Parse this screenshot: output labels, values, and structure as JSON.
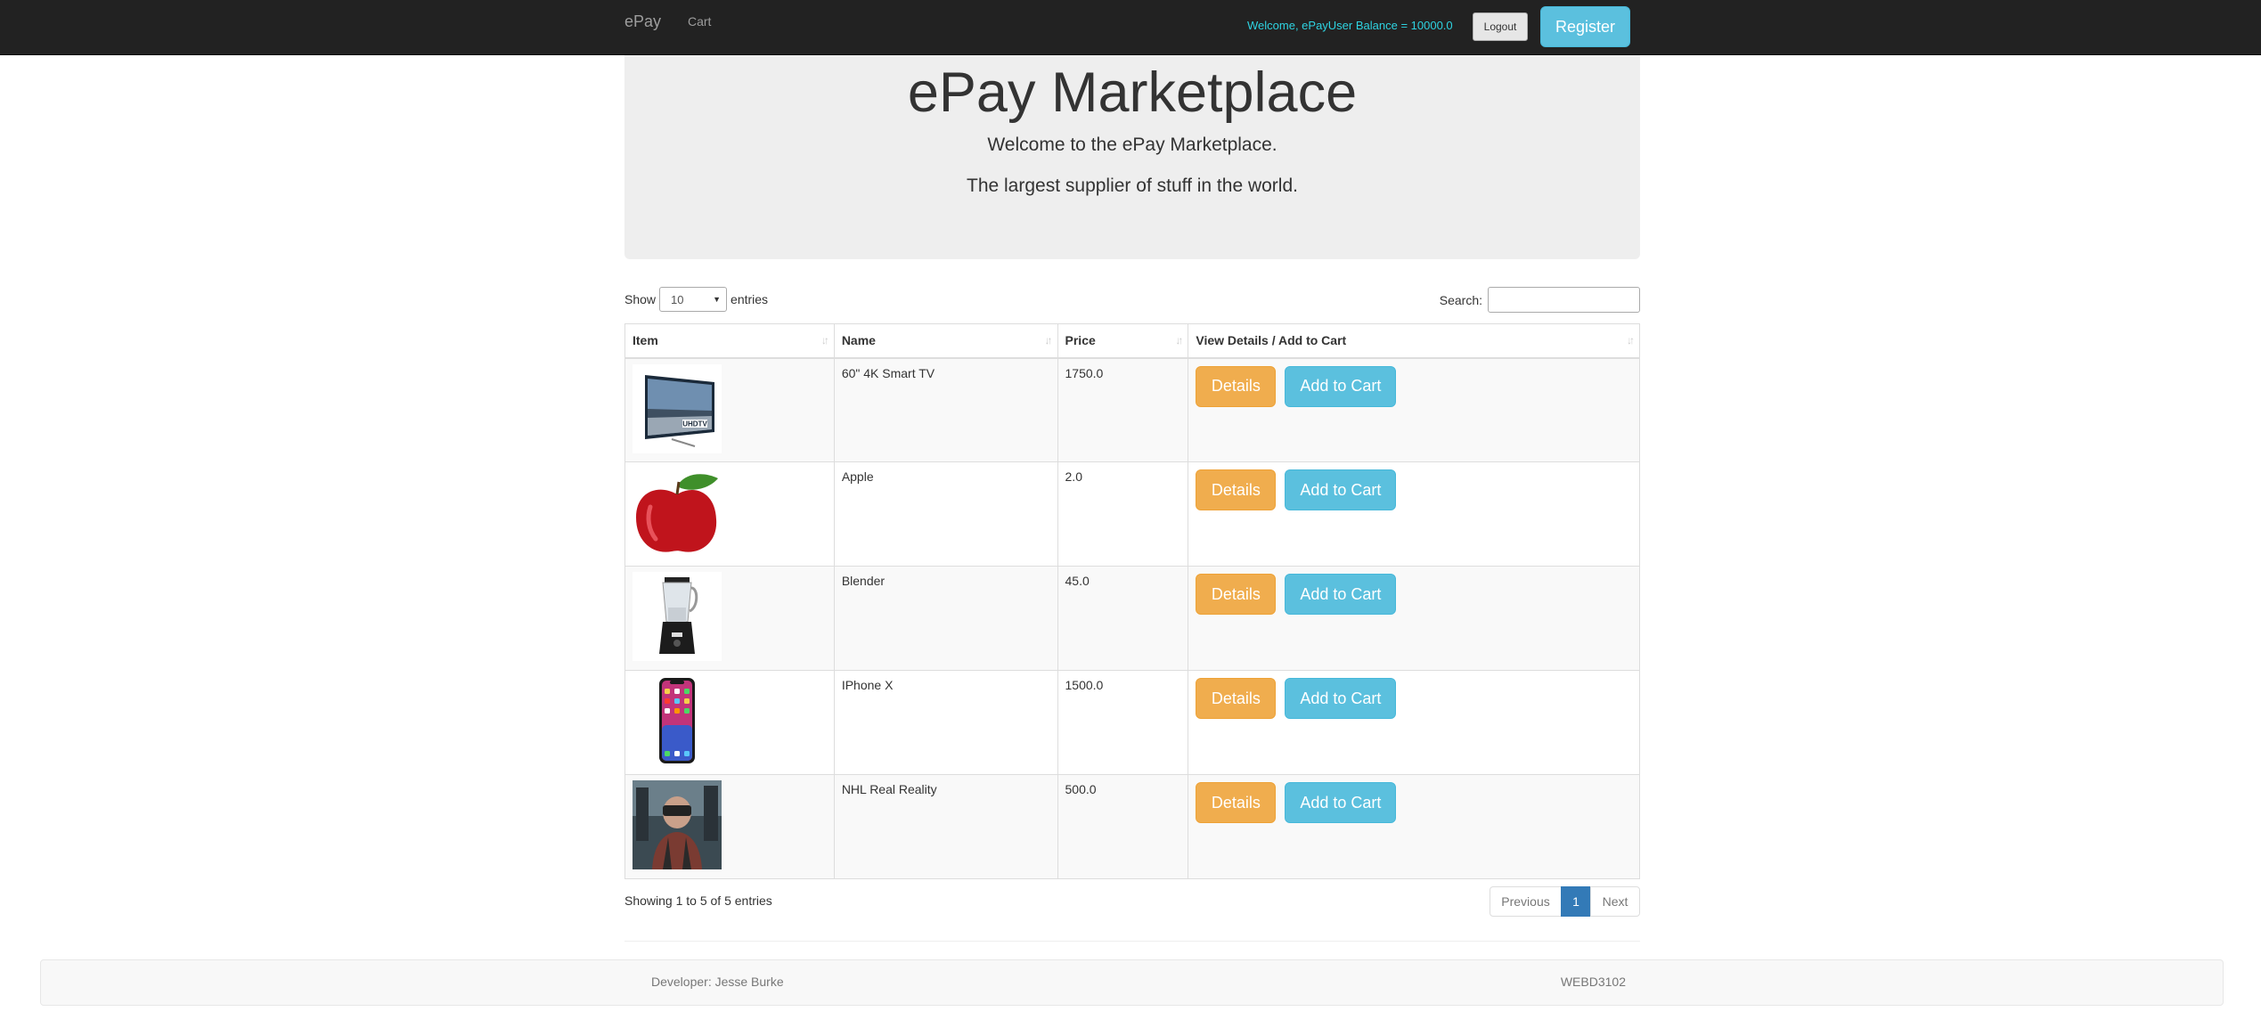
{
  "navbar": {
    "brand": "ePay",
    "cart_link": "Cart",
    "welcome_text": "Welcome, ePayUser Balance = 10000.0",
    "logout_label": "Logout",
    "register_label": "Register"
  },
  "jumbotron": {
    "title": "ePay Marketplace",
    "line1": "Welcome to the ePay Marketplace.",
    "line2": "The largest supplier of stuff in the world."
  },
  "table_controls": {
    "show_label": "Show",
    "entries_value": "10",
    "entries_label": "entries",
    "search_label": "Search:",
    "search_value": ""
  },
  "table": {
    "headers": [
      "Item",
      "Name",
      "Price",
      "View Details / Add to Cart"
    ],
    "rows": [
      {
        "image": "smart-tv",
        "name": "60\" 4K Smart TV",
        "price": "1750.0",
        "details_label": "Details",
        "cart_label": "Add to Cart"
      },
      {
        "image": "apple",
        "name": "Apple",
        "price": "2.0",
        "details_label": "Details",
        "cart_label": "Add to Cart"
      },
      {
        "image": "blender",
        "name": "Blender",
        "price": "45.0",
        "details_label": "Details",
        "cart_label": "Add to Cart"
      },
      {
        "image": "iphone",
        "name": "IPhone X",
        "price": "1500.0",
        "details_label": "Details",
        "cart_label": "Add to Cart"
      },
      {
        "image": "vr-headset-photo",
        "name": "NHL Real Reality",
        "price": "500.0",
        "details_label": "Details",
        "cart_label": "Add to Cart"
      }
    ]
  },
  "table_info": "Showing 1 to 5 of 5 entries",
  "pagination": {
    "previous": "Previous",
    "current": "1",
    "next": "Next"
  },
  "footer": {
    "developer": "Developer: Jesse Burke",
    "course": "WEBD3102"
  },
  "colors": {
    "navbar": "#222222",
    "welcome_text": "#2ed3e1",
    "info_button": "#5bc0de",
    "warning_button": "#f0ad4e",
    "active_page": "#337ab7"
  }
}
